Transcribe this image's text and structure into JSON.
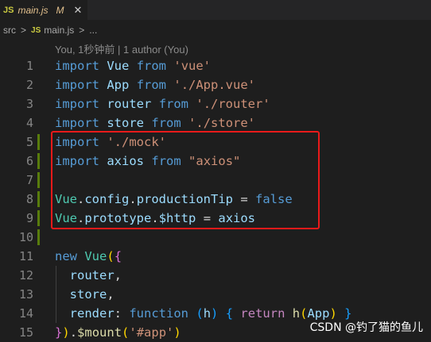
{
  "tab": {
    "icon": "JS",
    "filename": "main.js",
    "status": "M",
    "close": "✕"
  },
  "breadcrumb": {
    "folder": "src",
    "sep": ">",
    "file_icon": "JS",
    "file": "main.js",
    "tail": "..."
  },
  "blame": "You, 1秒钟前 | 1 author (You)",
  "lines": [
    {
      "n": "1",
      "tokens": [
        [
          "kw",
          "import"
        ],
        [
          "t",
          " "
        ],
        [
          "id",
          "Vue"
        ],
        [
          "t",
          " "
        ],
        [
          "kw",
          "from"
        ],
        [
          "t",
          " "
        ],
        [
          "st",
          "'vue'"
        ]
      ]
    },
    {
      "n": "2",
      "tokens": [
        [
          "kw",
          "import"
        ],
        [
          "t",
          " "
        ],
        [
          "id",
          "App"
        ],
        [
          "t",
          " "
        ],
        [
          "kw",
          "from"
        ],
        [
          "t",
          " "
        ],
        [
          "st",
          "'./App.vue'"
        ]
      ]
    },
    {
      "n": "3",
      "tokens": [
        [
          "kw",
          "import"
        ],
        [
          "t",
          " "
        ],
        [
          "id",
          "router"
        ],
        [
          "t",
          " "
        ],
        [
          "kw",
          "from"
        ],
        [
          "t",
          " "
        ],
        [
          "st",
          "'./router'"
        ]
      ]
    },
    {
      "n": "4",
      "tokens": [
        [
          "kw",
          "import"
        ],
        [
          "t",
          " "
        ],
        [
          "id",
          "store"
        ],
        [
          "t",
          " "
        ],
        [
          "kw",
          "from"
        ],
        [
          "t",
          " "
        ],
        [
          "st",
          "'./store'"
        ]
      ]
    },
    {
      "n": "5",
      "gutter": true,
      "tokens": [
        [
          "kw",
          "import"
        ],
        [
          "t",
          " "
        ],
        [
          "st",
          "'./mock'"
        ]
      ]
    },
    {
      "n": "6",
      "gutter": true,
      "tokens": [
        [
          "kw",
          "import"
        ],
        [
          "t",
          " "
        ],
        [
          "id",
          "axios"
        ],
        [
          "t",
          " "
        ],
        [
          "kw",
          "from"
        ],
        [
          "t",
          " "
        ],
        [
          "st",
          "\"axios\""
        ]
      ]
    },
    {
      "n": "7",
      "gutter": true,
      "tokens": []
    },
    {
      "n": "8",
      "gutter": true,
      "tokens": [
        [
          "ty",
          "Vue"
        ],
        [
          "t",
          "."
        ],
        [
          "id",
          "config"
        ],
        [
          "t",
          "."
        ],
        [
          "id",
          "productionTip"
        ],
        [
          "t",
          " = "
        ],
        [
          "kw",
          "false"
        ]
      ]
    },
    {
      "n": "9",
      "gutter": true,
      "tokens": [
        [
          "ty",
          "Vue"
        ],
        [
          "t",
          "."
        ],
        [
          "id",
          "prototype"
        ],
        [
          "t",
          "."
        ],
        [
          "id",
          "$http"
        ],
        [
          "t",
          " = "
        ],
        [
          "id",
          "axios"
        ]
      ]
    },
    {
      "n": "10",
      "gutter": true,
      "tokens": []
    },
    {
      "n": "11",
      "tokens": [
        [
          "kw",
          "new"
        ],
        [
          "t",
          " "
        ],
        [
          "ty",
          "Vue"
        ],
        [
          "br1",
          "("
        ],
        [
          "br2",
          "{"
        ]
      ]
    },
    {
      "n": "12",
      "tokens": [
        [
          "t",
          "  "
        ],
        [
          "id",
          "router"
        ],
        [
          "t",
          ","
        ]
      ]
    },
    {
      "n": "13",
      "tokens": [
        [
          "t",
          "  "
        ],
        [
          "id",
          "store"
        ],
        [
          "t",
          ","
        ]
      ]
    },
    {
      "n": "14",
      "tokens": [
        [
          "t",
          "  "
        ],
        [
          "id",
          "render"
        ],
        [
          "t",
          ": "
        ],
        [
          "kw",
          "function"
        ],
        [
          "t",
          " "
        ],
        [
          "br3",
          "("
        ],
        [
          "id",
          "h"
        ],
        [
          "br3",
          ")"
        ],
        [
          "t",
          " "
        ],
        [
          "br3",
          "{"
        ],
        [
          "t",
          " "
        ],
        [
          "ret",
          "return"
        ],
        [
          "t",
          " "
        ],
        [
          "fn",
          "h"
        ],
        [
          "br1",
          "("
        ],
        [
          "id",
          "App"
        ],
        [
          "br1",
          ")"
        ],
        [
          "t",
          " "
        ],
        [
          "br3",
          "}"
        ]
      ]
    },
    {
      "n": "15",
      "tokens": [
        [
          "br2",
          "}"
        ],
        [
          "br1",
          ")"
        ],
        [
          "t",
          "."
        ],
        [
          "fn",
          "$mount"
        ],
        [
          "br1",
          "("
        ],
        [
          "st",
          "'#app'"
        ],
        [
          "br1",
          ")"
        ]
      ]
    }
  ],
  "watermark": "CSDN @钓了猫的鱼儿"
}
